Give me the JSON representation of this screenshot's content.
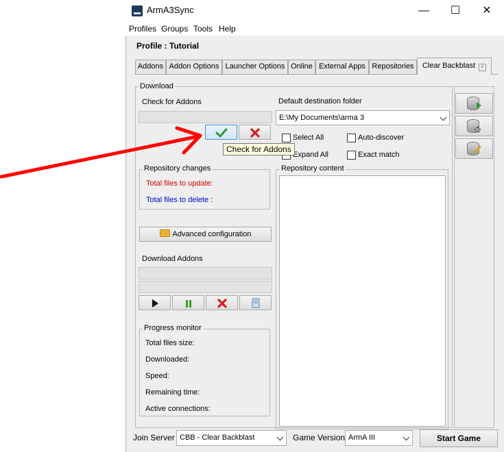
{
  "window": {
    "title": "ArmA3Sync",
    "minimize": "—",
    "maximize": "☐",
    "close": "✕"
  },
  "menu": [
    "Profiles",
    "Groups",
    "Tools",
    "Help"
  ],
  "profile_title": "Profile : Tutorial",
  "tabs": [
    {
      "label": "Addons",
      "selected": false
    },
    {
      "label": "Addon Options",
      "selected": false
    },
    {
      "label": "Launcher Options",
      "selected": false
    },
    {
      "label": "Online",
      "selected": false
    },
    {
      "label": "External Apps",
      "selected": false
    },
    {
      "label": "Repositories",
      "selected": false
    },
    {
      "label": "Clear Backblast",
      "selected": true
    }
  ],
  "download": {
    "group_label": "Download",
    "check_for_addons_label": "Check for Addons",
    "default_destination_label": "Default destination folder",
    "destination_value": "E:\\My Documents\\arma 3",
    "select_all": "Select All",
    "auto_discover": "Auto-discover",
    "expand_all": "Expand All",
    "exact_match": "Exact match",
    "tooltip": "Check for Addons",
    "repo_changes": {
      "label": "Repository changes",
      "files_update": "Total files to update:",
      "files_delete": "Total files to delete :"
    },
    "repo_content_label": "Repository content",
    "advanced_config": "Advanced configuration",
    "download_addons_label": "Download Addons",
    "progress": {
      "label": "Progress monitor",
      "items": [
        "Total files size:",
        "Downloaded:",
        "Speed:",
        "Remaining time:",
        "Active connections:"
      ]
    }
  },
  "bottom": {
    "join_server_label": "Join Server",
    "join_server_value": "CBB - Clear Backblast",
    "game_version_label": "Game Version",
    "game_version_value": "ArmA III",
    "start_game": "Start Game"
  },
  "colors": {
    "update_text": "#d40000",
    "delete_text": "#0000c8",
    "arrow": "#ff0000",
    "tooltip_bg": "#ffffe1",
    "check_green": "#2e9a2e",
    "cancel_red": "#d22020"
  },
  "icons": [
    "check-icon",
    "cancel-icon",
    "folder-icon",
    "play-icon",
    "pause-icon",
    "stop-icon",
    "log-icon",
    "db-sync-icon",
    "db-settings-icon",
    "db-edit-icon",
    "red-arrow-annotation"
  ]
}
